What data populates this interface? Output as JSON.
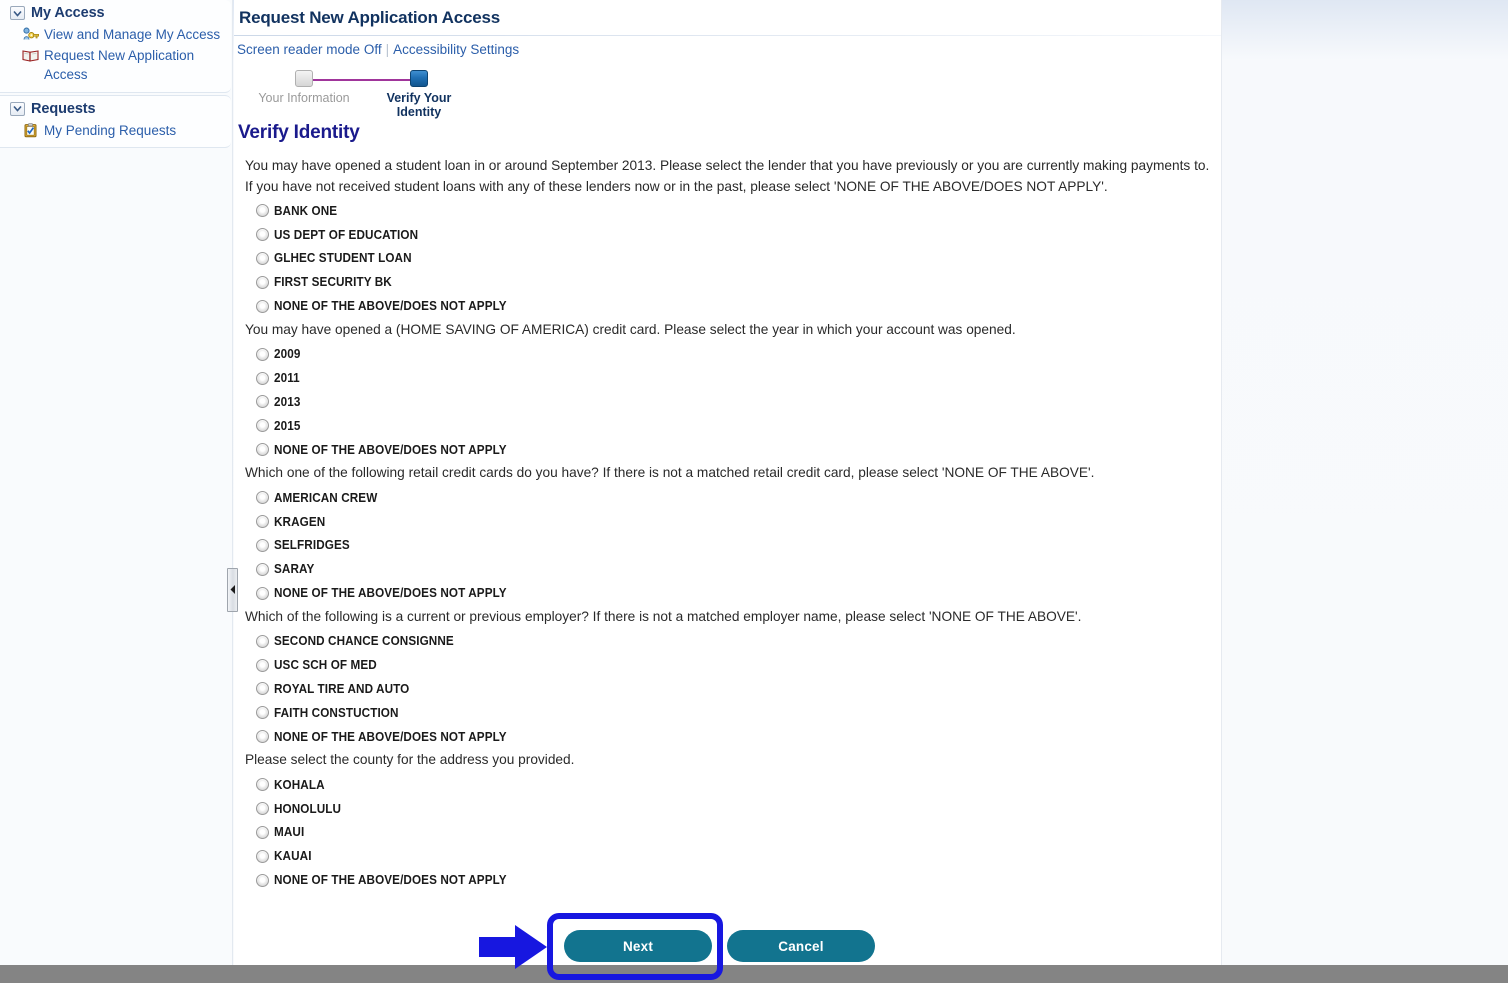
{
  "sidebar": {
    "groups": [
      {
        "title": "My Access",
        "collapse_icon": "chevron-down-icon",
        "items": [
          {
            "label": "View and Manage My Access",
            "icon": "key-person-icon"
          },
          {
            "label": "Request New Application Access",
            "icon": "open-book-icon"
          }
        ]
      },
      {
        "title": "Requests",
        "collapse_icon": "chevron-down-icon",
        "items": [
          {
            "label": "My Pending Requests",
            "icon": "clipboard-check-icon"
          }
        ]
      }
    ],
    "splitter_handle_icon": "triangle-left-icon"
  },
  "header": {
    "title": "Request New Application Access",
    "screen_reader_link": "Screen reader mode Off",
    "separator": "|",
    "accessibility_link": "Accessibility Settings"
  },
  "wizard": {
    "steps": [
      {
        "label": "Your Information",
        "state": "inactive"
      },
      {
        "label": "Verify Your Identity",
        "state": "active"
      }
    ],
    "connector_color": "#a0359b"
  },
  "main": {
    "section_heading": "Verify Identity",
    "questions": [
      {
        "text": "You may have opened a student loan in or around September 2013. Please select the lender that you have previously or you are currently making payments to. If you have not received student loans with any of these lenders now or in the past, please select 'NONE OF THE ABOVE/DOES NOT APPLY'.",
        "options": [
          "BANK ONE",
          "US DEPT OF EDUCATION",
          "GLHEC STUDENT LOAN",
          "FIRST SECURITY BK",
          "NONE OF THE ABOVE/DOES NOT APPLY"
        ]
      },
      {
        "text": "You may have opened a (HOME SAVING OF AMERICA) credit card. Please select the year in which your account was opened.",
        "options": [
          "2009",
          "2011",
          "2013",
          "2015",
          "NONE OF THE ABOVE/DOES NOT APPLY"
        ]
      },
      {
        "text": "Which one of the following retail credit cards do you have? If there is not a matched retail credit card, please select 'NONE OF THE ABOVE'.",
        "options": [
          "AMERICAN CREW",
          "KRAGEN",
          "SELFRIDGES",
          "SARAY",
          "NONE OF THE ABOVE/DOES NOT APPLY"
        ]
      },
      {
        "text": "Which of the following is a current or previous employer? If there is not a matched employer name, please select 'NONE OF THE ABOVE'.",
        "options": [
          "SECOND CHANCE CONSIGNNE",
          "USC SCH OF MED",
          "ROYAL TIRE AND AUTO",
          "FAITH CONSTUCTION",
          "NONE OF THE ABOVE/DOES NOT APPLY"
        ]
      },
      {
        "text": "Please select the county for the address you provided.",
        "options": [
          "KOHALA",
          "HONOLULU",
          "MAUI",
          "KAUAI",
          "NONE OF THE ABOVE/DOES NOT APPLY"
        ]
      }
    ]
  },
  "footer": {
    "next_label": "Next",
    "cancel_label": "Cancel",
    "button_color": "#12748f"
  },
  "annotation": {
    "highlight_color": "#1717e0",
    "arrow_icon": "arrow-right-icon",
    "target": "Next"
  }
}
